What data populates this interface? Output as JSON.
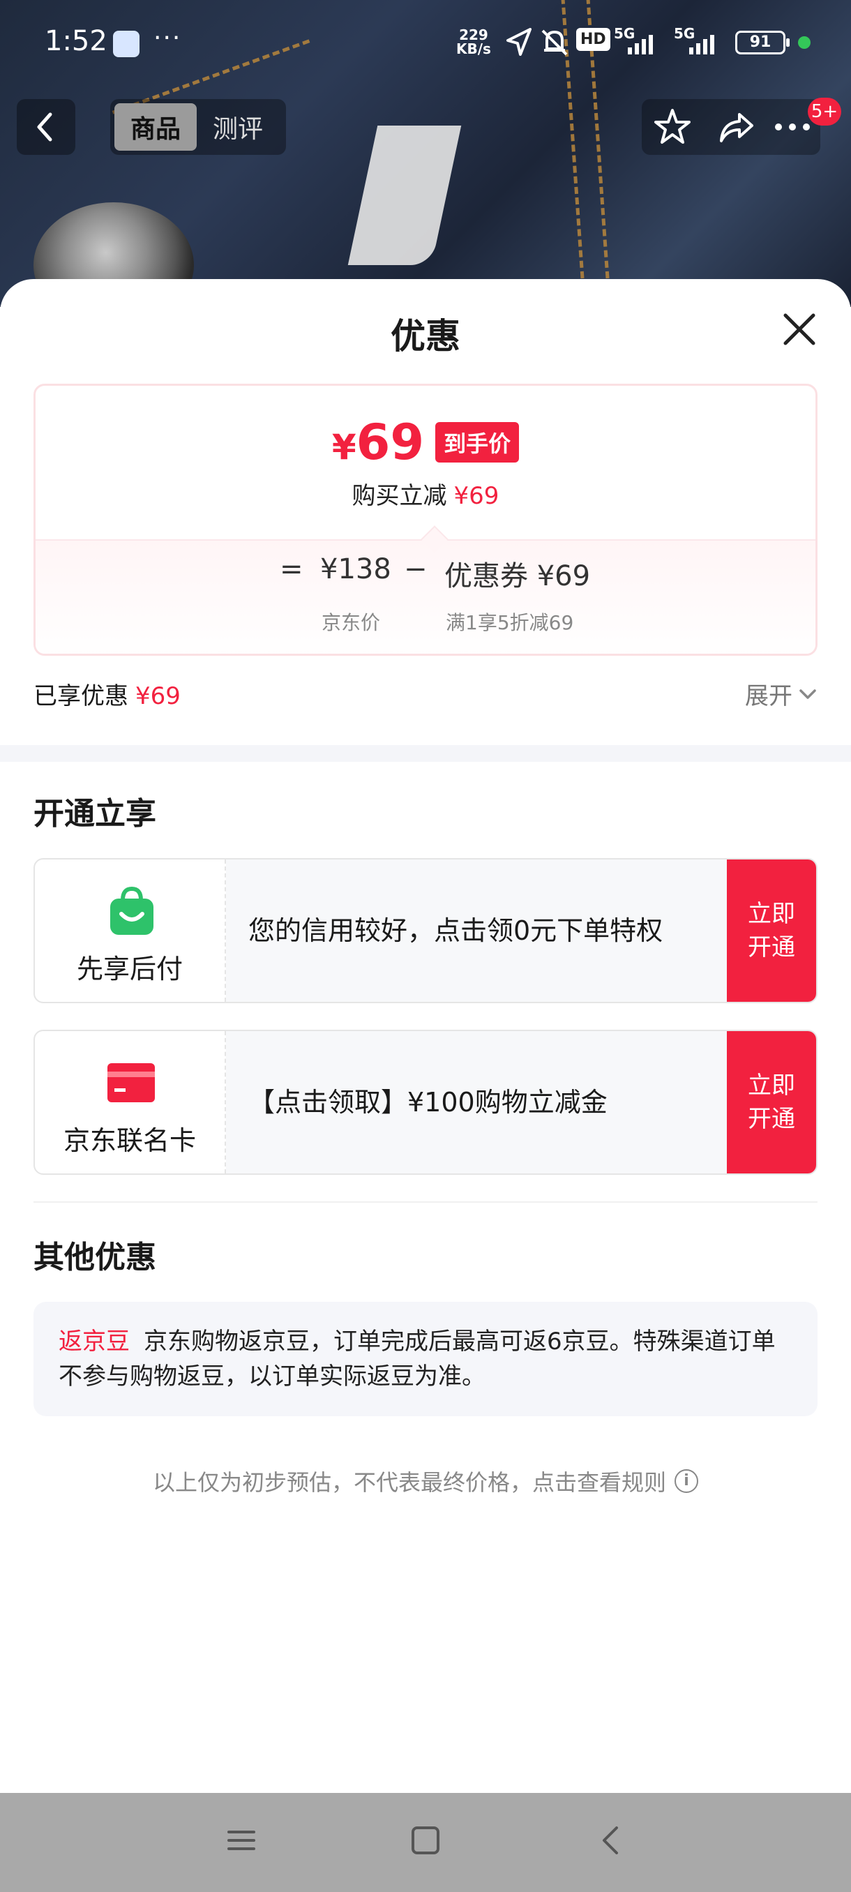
{
  "status_bar": {
    "time": "1:52",
    "more": "···",
    "net_speed_value": "229",
    "net_speed_unit": "KB/s",
    "battery": "91",
    "signal_1": "5G",
    "signal_2": "5G",
    "hd": "HD"
  },
  "top_nav": {
    "tabs": [
      "商品",
      "测评"
    ],
    "badge": "5+"
  },
  "sheet": {
    "title": "优惠",
    "price_card": {
      "currency": "¥",
      "final_price": "69",
      "final_tag": "到手价",
      "instant_discount_label": "购买立减",
      "instant_discount_value": "¥69",
      "equals": "=",
      "jd_price": "¥138",
      "minus": "−",
      "coupon": "优惠券 ¥69",
      "jd_price_label": "京东价",
      "coupon_rule": "满1享5折减69"
    },
    "enjoyed_label": "已享优惠",
    "enjoyed_value": "¥69",
    "expand_label": "展开",
    "open_section_title": "开通立享",
    "offers": [
      {
        "name": "先享后付",
        "desc": "您的信用较好，点击领0元下单特权",
        "button": "立即开通",
        "icon": "shopping-bag-icon"
      },
      {
        "name": "京东联名卡",
        "desc": "【点击领取】¥100购物立减金",
        "button": "立即开通",
        "icon": "credit-card-icon"
      }
    ],
    "other_section_title": "其他优惠",
    "other": {
      "tag": "返京豆",
      "text": "京东购物返京豆，订单完成后最高可返6京豆。特殊渠道订单不参与购物返豆，以订单实际返豆为准。"
    },
    "footnote": "以上仅为初步预估，不代表最终价格，点击查看规则"
  },
  "colors": {
    "accent_red": "#f2213f",
    "green_icon": "#2ec26a"
  }
}
